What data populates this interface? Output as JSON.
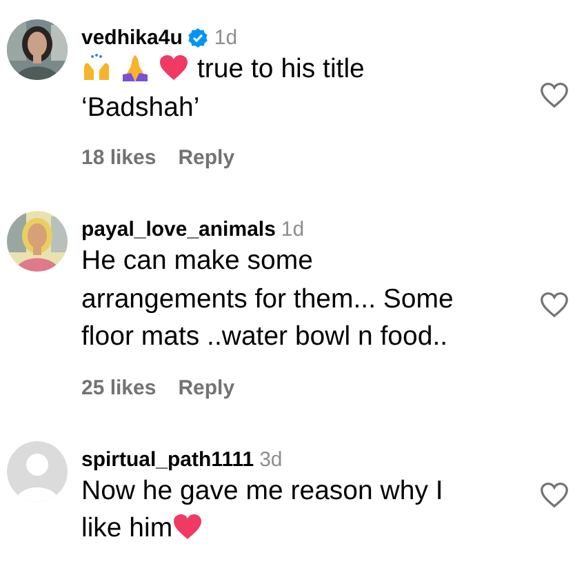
{
  "comments": [
    {
      "avatar": {
        "kind": "picture"
      },
      "username": "vedhika4u",
      "verified": true,
      "age": "1d",
      "lines": [
        [
          {
            "kind": "raised-hands"
          },
          {
            "kind": "folded-hands"
          },
          {
            "kind": "heart"
          },
          {
            "kind": "text",
            "text": "true to his title"
          }
        ],
        [
          {
            "kind": "text",
            "text": "‘Badshah’"
          }
        ]
      ],
      "likes": "18 likes",
      "reply": "Reply",
      "liked": false
    },
    {
      "avatar": {
        "kind": "picture"
      },
      "username": "payal_love_animals",
      "verified": false,
      "age": "1d",
      "lines": [
        [
          {
            "kind": "text",
            "text": "He can make some arrangements for them... Some floor mats ..water bowl n food.."
          }
        ]
      ],
      "likes": "25 likes",
      "reply": "Reply",
      "liked": false
    },
    {
      "avatar": {
        "kind": "placeholder"
      },
      "username": "spirtual_path1111",
      "verified": false,
      "age": "3d",
      "lines": [
        [
          {
            "kind": "text",
            "text": "Now he gave me reason why I"
          }
        ],
        [
          {
            "kind": "text",
            "text": "like him"
          },
          {
            "kind": "heart"
          }
        ]
      ],
      "liked": false
    }
  ]
}
